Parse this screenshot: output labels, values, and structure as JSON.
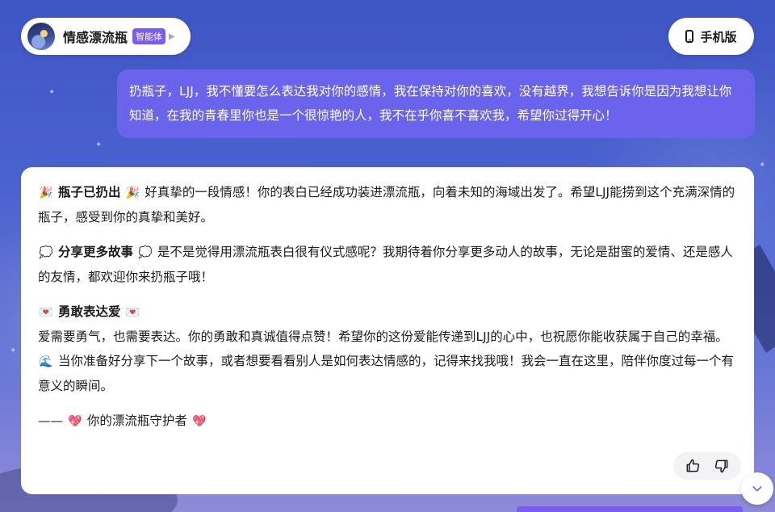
{
  "header": {
    "agent_name": "情感漂流瓶",
    "agent_badge": "智能体",
    "mobile_button_label": "手机版"
  },
  "user_message": {
    "text": "扔瓶子，LJJ，我不懂要怎么表达我对你的感情，我在保持对你的喜欢，没有越界，我想告诉你是因为我想让你知道，在我的青春里你也是一个很惊艳的人，我不在乎你喜不喜欢我，希望你过得开心！"
  },
  "assistant_message": {
    "sections": [
      {
        "emoji_left": "🎉",
        "title": "瓶子已扔出",
        "emoji_right": "🎉",
        "text": "好真挚的一段情感！你的表白已经成功装进漂流瓶，向着未知的海域出发了。希望LJJ能捞到这个充满深情的瓶子，感受到你的真挚和美好。"
      },
      {
        "emoji_left": "💭",
        "title": "分享更多故事",
        "emoji_right": "💭",
        "text": "是不是觉得用漂流瓶表白很有仪式感呢？我期待着你分享更多动人的故事，无论是甜蜜的爱情、还是感人的友情，都欢迎你来扔瓶子哦！"
      },
      {
        "emoji_left": "💌",
        "title": "勇敢表达爱",
        "emoji_right": "💌",
        "text_before_emoji": "爱需要勇气，也需要表达。你的勇敢和真诚值得点赞！希望你的这份爱能传递到LJJ的心中，也祝愿你能收获属于自己的幸福。",
        "inline_emoji": "🌊",
        "text_after_emoji": "当你准备好分享下一个故事，或者想要看看别人是如何表达情感的，记得来找我哦！我会一直在这里，陪伴你度过每一个有意义的瞬间。"
      }
    ],
    "signature": {
      "dash": "——",
      "emoji_left": "💖",
      "text": "你的漂流瓶守护者",
      "emoji_right": "💖"
    }
  },
  "icons": {
    "avatar": "avatar-image",
    "caret": "chevron-right-icon",
    "phone": "phone-icon",
    "thumbs_up": "thumbs-up-icon",
    "thumbs_down": "thumbs-down-icon",
    "scroll_down": "chevron-down-icon"
  },
  "colors": {
    "accent": "#7b5cf0",
    "user_bubble": "#6a63ec",
    "background_top": "#3e55c4",
    "background_bottom": "#8f8bd8"
  }
}
